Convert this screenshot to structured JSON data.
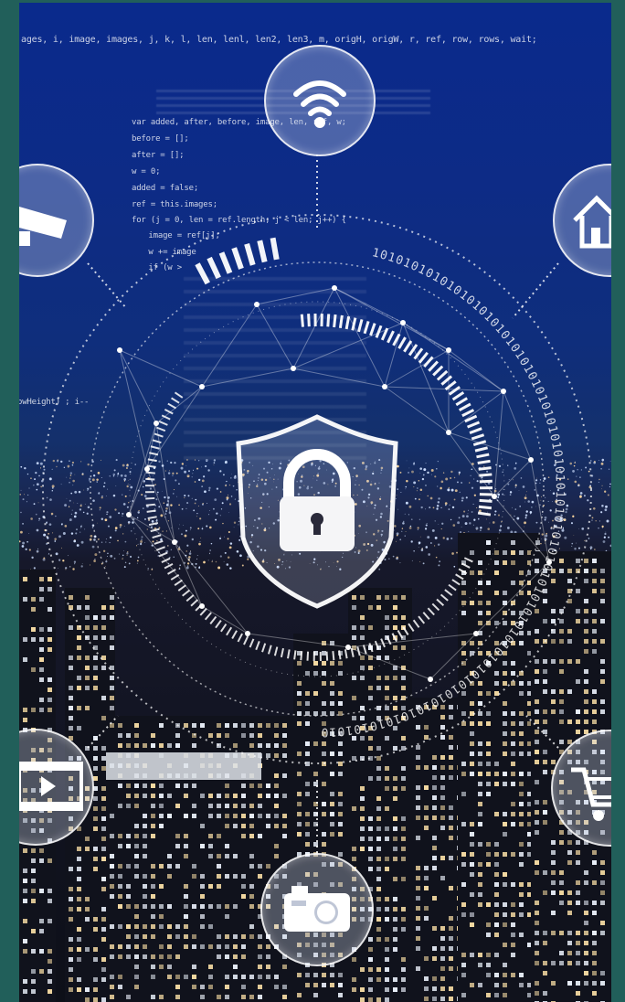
{
  "image": {
    "subject": "Cybersecurity network overlay on a night city skyline",
    "code_lines": [
      "ages, i, image, images, j, k, l, len, lenl, len2, len3, m, origH, origW, r, ref, row, rows, wait;",
      "var added, after, before, image, len, ref, w;",
      "before = [];",
      "after = [];",
      "w = 0;",
      "added = false;",
      "ref = this.images;",
      "for (j = 0, len = ref.length; j < len; j++) {",
      "  image = ref[j];",
      "  w += image",
      "  if (w >",
      "owHeight) ; i--"
    ],
    "binary_ring_text": "10101010101010101010101010101010101010101010101010101010101010101010101010101010101010",
    "icons": [
      "wifi-icon",
      "security-camera-icon",
      "home-icon",
      "padlock-icon",
      "video-icon",
      "shopping-cart-icon",
      "camera-icon"
    ],
    "colors": {
      "frame": "#215f5a",
      "sky_top": "#0a2a8c",
      "glow": "#ffffff"
    }
  }
}
